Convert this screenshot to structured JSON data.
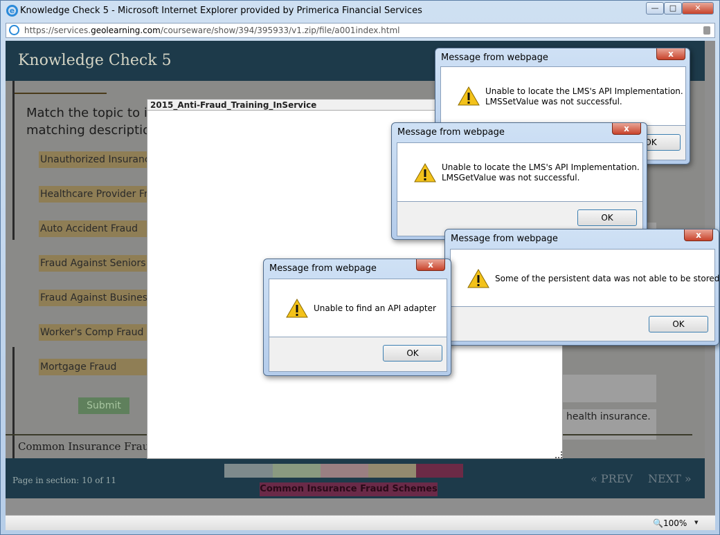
{
  "browser": {
    "title": "Knowledge Check 5 - Microsoft Internet Explorer provided by Primerica Financial Services",
    "url_prefix": "https://services.",
    "url_domain": "geolearning.com",
    "url_path": "/courseware/show/394/395933/v1.zip/file/a001index.html",
    "minimize": "—",
    "maximize": "□",
    "close": "✕",
    "zoom": "100%",
    "zoom_arrow": "▾",
    "zoom_icon": "🔍"
  },
  "course": {
    "title": "Knowledge Check 5",
    "question": "Match the topic to it matching description",
    "topics": [
      "Unauthorized Insurance",
      "Healthcare Provider Fraud",
      "Auto Accident Fraud",
      "Fraud Against Seniors",
      "Fraud Against Businesses",
      "Worker's Comp Fraud",
      "Mortgage Fraud"
    ],
    "submit": "Submit",
    "section_label": "Common Insurance Fraud S",
    "visible_description_fragment": "health insurance.",
    "page_indicator": "Page in section: 10 of 11",
    "section_name": "Common Insurance Fraud Schemes",
    "prev": "« PREV",
    "next": "NEXT »",
    "swatch_colors": [
      "#7e8a8c",
      "#8a9a80",
      "#9a7f82",
      "#938a6f",
      "#6c2a46"
    ]
  },
  "popup": {
    "title": "2015_Anti-Fraud_Training_InService"
  },
  "dialogs": [
    {
      "title": "Message from webpage",
      "line1": "Unable to locate the LMS's API Implementation.",
      "line2": "LMSSetValue was not successful.",
      "ok": "OK",
      "close": "x"
    },
    {
      "title": "Message from webpage",
      "line1": "Unable to locate the LMS's API Implementation.",
      "line2": "LMSGetValue was not successful.",
      "ok": "OK",
      "close": "x"
    },
    {
      "title": "Message from webpage",
      "line1": "Some of the persistent data was not able to be stored",
      "line2": "",
      "ok": "OK",
      "close": "x"
    },
    {
      "title": "Message from webpage",
      "line1": "Unable to find an API adapter",
      "line2": "",
      "ok": "OK",
      "close": "x"
    }
  ]
}
